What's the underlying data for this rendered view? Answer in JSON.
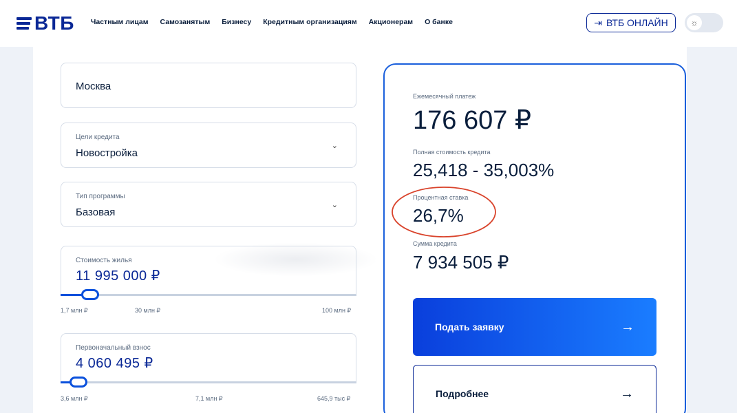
{
  "header": {
    "logo": "ВТБ",
    "nav": [
      "Частным лицам",
      "Самозанятым",
      "Бизнесу",
      "Кредитным организациям",
      "Акционерам",
      "О банке"
    ],
    "online_button": "ВТБ ОНЛАЙН",
    "login_icon": "login-arrow-icon",
    "theme_icon": "sun-icon"
  },
  "form": {
    "city": {
      "value": "Москва"
    },
    "purpose": {
      "label": "Цели кредита",
      "value": "Новостройка"
    },
    "program": {
      "label": "Тип программы",
      "value": "Базовая"
    },
    "property_cost": {
      "label": "Стоимость жилья",
      "value": "11 995 000 ₽",
      "ticks": [
        "1,7 млн ₽",
        "30 млн ₽",
        "100 млн ₽"
      ],
      "level": 0.1
    },
    "down_payment": {
      "label": "Первоначальный взнос",
      "value": "4 060 495 ₽",
      "ticks": [
        "3,6 млн ₽",
        "7,1 млн ₽",
        "645,9 тыс ₽"
      ],
      "level": 0.06
    }
  },
  "result": {
    "monthly_label": "Ежемесячный платеж",
    "monthly_value": "176 607 ₽",
    "psk_label": "Полная стоимость кредита",
    "psk_value": "25,418 - 35,003%",
    "rate_label": "Процентная ставка",
    "rate_value": "26,7%",
    "amount_label": "Сумма кредита",
    "amount_value": "7 934 505 ₽",
    "apply_button": "Подать заявку",
    "more_button": "Подробнее",
    "arrow": "→"
  },
  "colors": {
    "brand": "#0a2896",
    "accent": "#0a50dc",
    "annotation": "#d9432b"
  }
}
